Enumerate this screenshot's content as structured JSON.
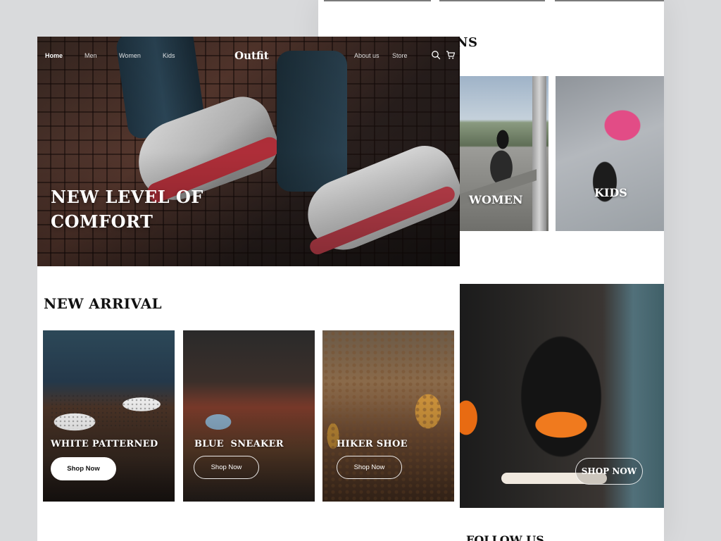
{
  "back_page": {
    "section_heading": "NS",
    "categories": [
      {
        "label": "WOMEN"
      },
      {
        "label": "KIDS"
      }
    ],
    "feature": {
      "button_label": "SHOP NOW"
    },
    "footer_heading": "FOLLOW US"
  },
  "nav": {
    "left_links": [
      {
        "label": "Home"
      },
      {
        "label": "Men"
      },
      {
        "label": "Women"
      },
      {
        "label": "Kids"
      }
    ],
    "brand": "Outfit",
    "right_links": [
      {
        "label": "About us"
      },
      {
        "label": "Store"
      }
    ],
    "icons": [
      "search-icon",
      "cart-icon"
    ]
  },
  "hero": {
    "title_line1": "NEW LEVEL OF",
    "title_line2": "COMFORT"
  },
  "new_arrival": {
    "title": "NEW ARRIVAL",
    "products": [
      {
        "name": "WHITE PATTERNED",
        "button": "Shop Now"
      },
      {
        "name": "BLUE  SNEAKER",
        "button": "Shop Now"
      },
      {
        "name": "HIKER SHOE",
        "button": "Shop Now"
      }
    ]
  },
  "colors": {
    "background": "#d9dadc",
    "page": "#ffffff",
    "text": "#111111"
  }
}
